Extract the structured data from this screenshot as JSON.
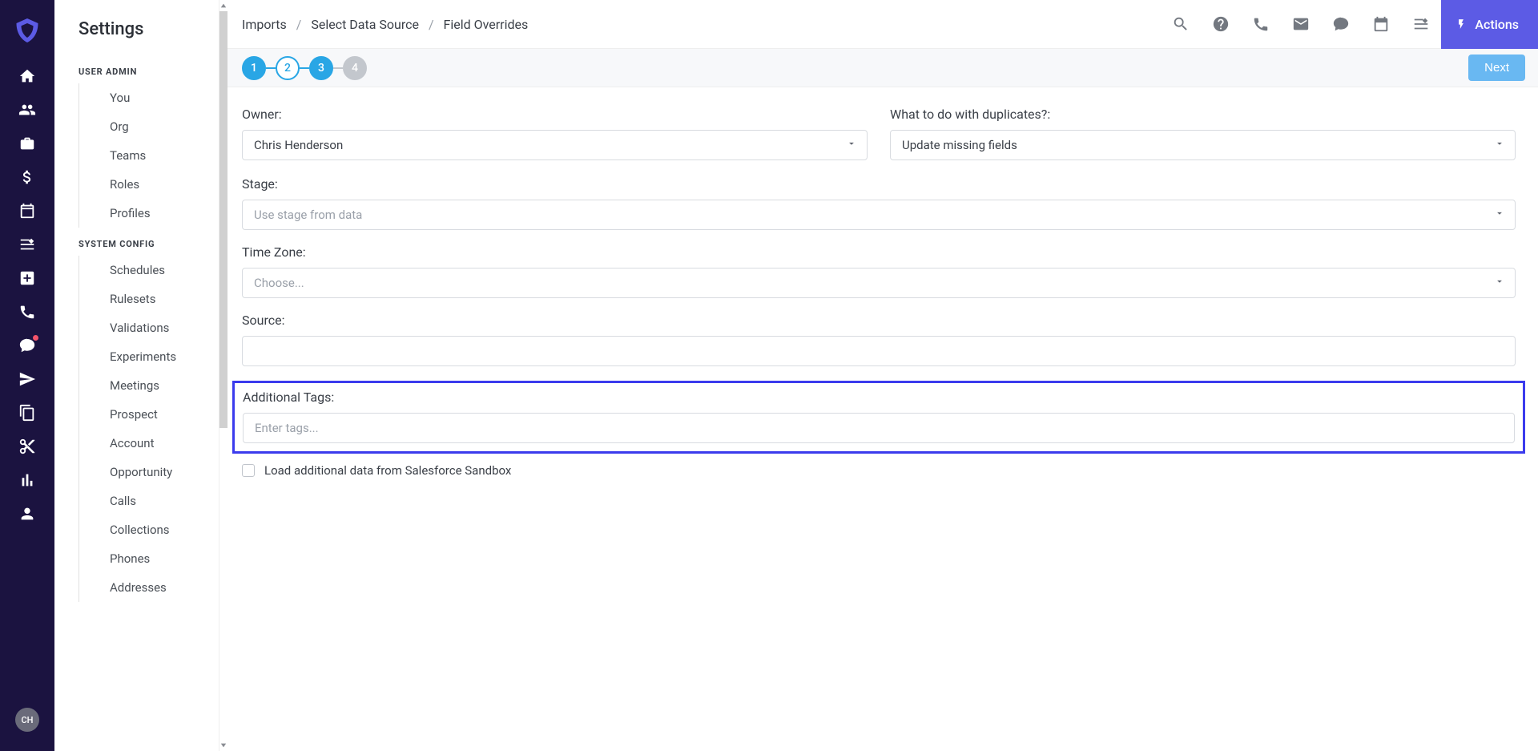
{
  "rail": {
    "avatar_initials": "CH"
  },
  "sidebar": {
    "title": "Settings",
    "sections": [
      {
        "label": "USER ADMIN",
        "items": [
          "You",
          "Org",
          "Teams",
          "Roles",
          "Profiles"
        ]
      },
      {
        "label": "SYSTEM CONFIG",
        "items": [
          "Schedules",
          "Rulesets",
          "Validations",
          "Experiments",
          "Meetings",
          "Prospect",
          "Account",
          "Opportunity",
          "Calls",
          "Collections",
          "Phones",
          "Addresses"
        ]
      }
    ]
  },
  "breadcrumb": {
    "a": "Imports",
    "b": "Select Data Source",
    "c": "Field Overrides",
    "sep": "/"
  },
  "actions_label": "Actions",
  "stepper": {
    "s1": "1",
    "s2": "2",
    "s3": "3",
    "s4": "4",
    "next_label": "Next"
  },
  "form": {
    "owner": {
      "label": "Owner:",
      "value": "Chris Henderson"
    },
    "duplicates": {
      "label": "What to do with duplicates?:",
      "value": "Update missing fields"
    },
    "stage": {
      "label": "Stage:",
      "placeholder": "Use stage from data"
    },
    "timezone": {
      "label": "Time Zone:",
      "placeholder": "Choose..."
    },
    "source": {
      "label": "Source:"
    },
    "tags": {
      "label": "Additional Tags:",
      "placeholder": "Enter tags..."
    },
    "checkbox": {
      "label": "Load additional data from Salesforce Sandbox"
    }
  }
}
